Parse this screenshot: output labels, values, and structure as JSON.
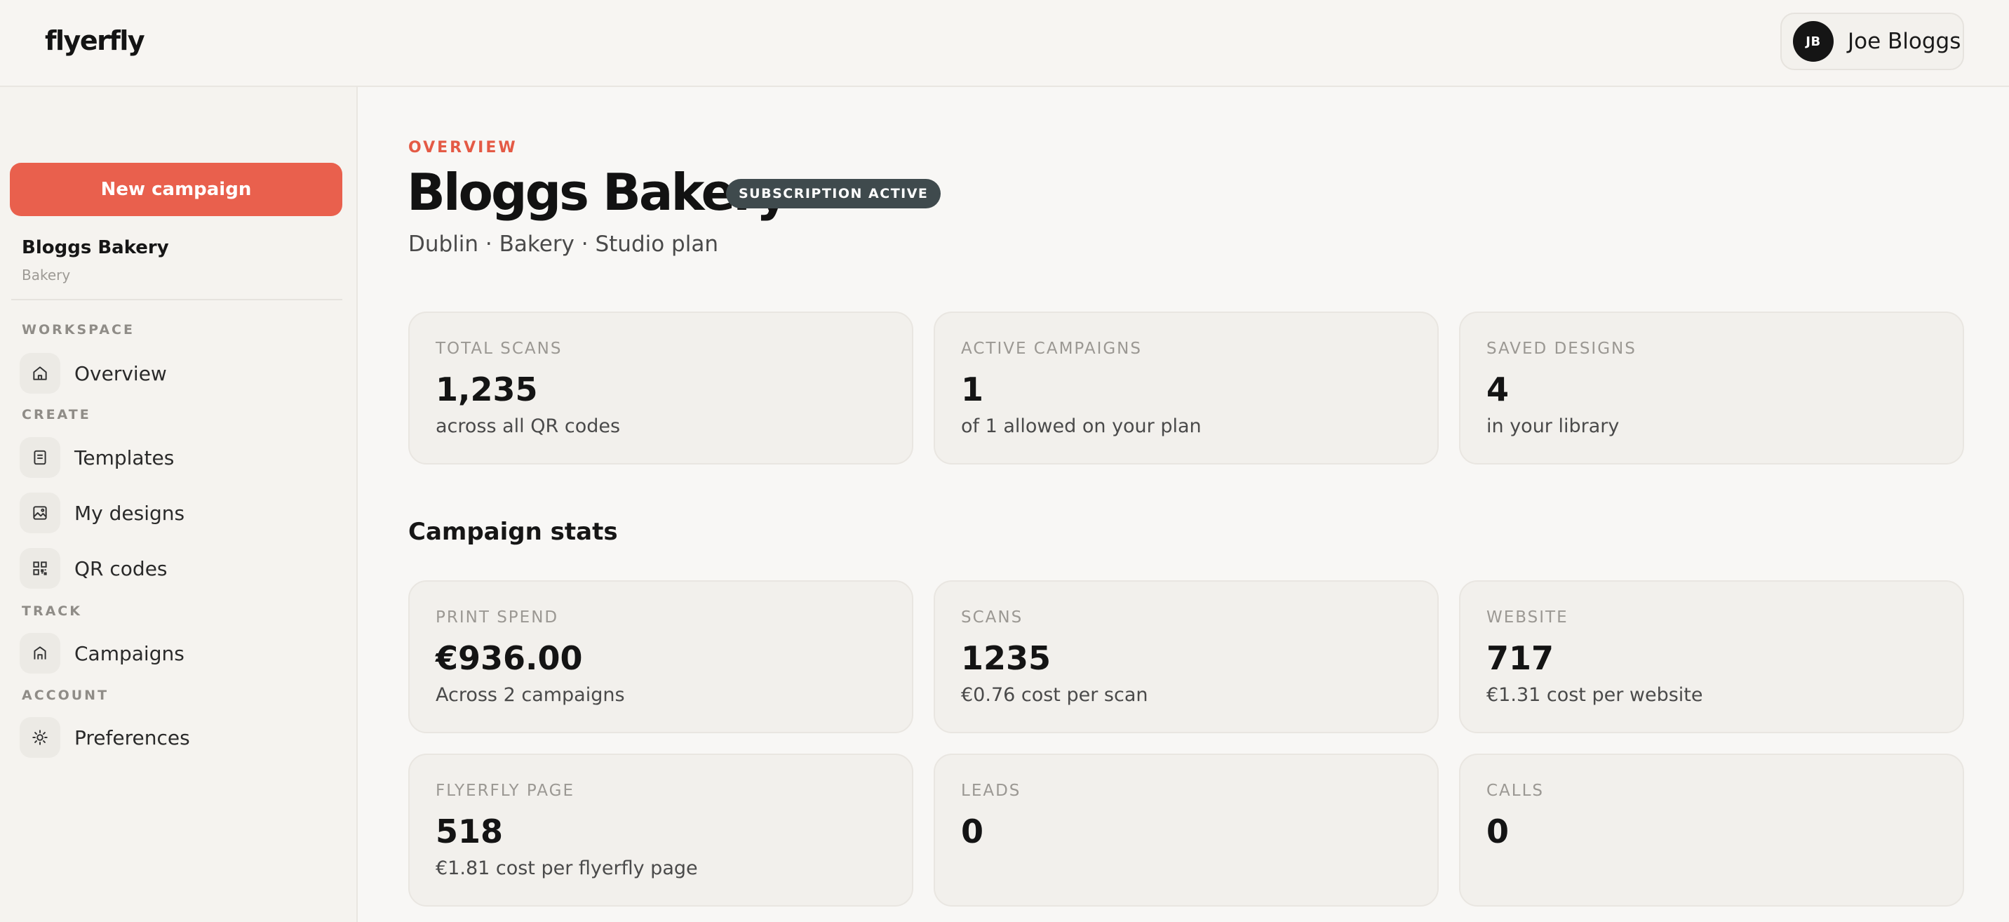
{
  "app": {
    "logo": "flyerfly"
  },
  "user": {
    "initials": "JB",
    "name": "Joe Bloggs"
  },
  "sidebar": {
    "new_campaign_label": "New campaign",
    "business_name": "Bloggs Bakery",
    "business_category": "Bakery",
    "sections": {
      "workspace": "WORKSPACE",
      "create": "CREATE",
      "track": "TRACK",
      "account": "ACCOUNT"
    },
    "items": {
      "overview": "Overview",
      "templates": "Templates",
      "my_designs": "My designs",
      "qr_codes": "QR codes",
      "campaigns": "Campaigns",
      "preferences": "Preferences"
    }
  },
  "header": {
    "eyebrow": "OVERVIEW",
    "title": "Bloggs Bakery",
    "badge": "SUBSCRIPTION ACTIVE",
    "subtitle": "Dublin · Bakery · Studio plan"
  },
  "summary_cards": [
    {
      "label": "TOTAL SCANS",
      "value": "1,235",
      "note": "across all QR codes"
    },
    {
      "label": "ACTIVE CAMPAIGNS",
      "value": "1",
      "note": "of 1 allowed on your plan"
    },
    {
      "label": "SAVED DESIGNS",
      "value": "4",
      "note": "in your library"
    }
  ],
  "campaign_stats": {
    "title": "Campaign stats",
    "cards": [
      {
        "label": "PRINT SPEND",
        "value": "€936.00",
        "note": "Across 2 campaigns"
      },
      {
        "label": "SCANS",
        "value": "1235",
        "note": "€0.76 cost per scan"
      },
      {
        "label": "WEBSITE",
        "value": "717",
        "note": "€1.31 cost per website"
      },
      {
        "label": "FLYERFLY PAGE",
        "value": "518",
        "note": "€1.81 cost per flyerfly page"
      },
      {
        "label": "LEADS",
        "value": "0",
        "note": ""
      },
      {
        "label": "CALLS",
        "value": "0",
        "note": ""
      }
    ]
  },
  "colors": {
    "accent": "#e9604d",
    "badge_bg": "#3f4a4d",
    "background": "#f8f7f5",
    "card_bg": "#f2f0ec"
  }
}
